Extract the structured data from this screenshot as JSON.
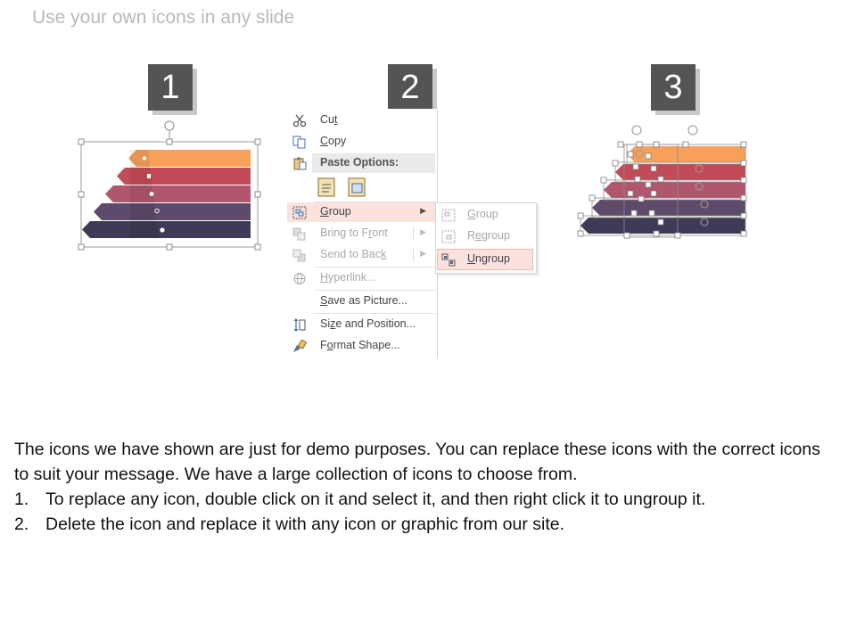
{
  "slide": {
    "title": "Use your own icons in any slide",
    "steps": [
      "1",
      "2",
      "3"
    ]
  },
  "colors": {
    "orange": "#f6a05a",
    "red": "#c24b58",
    "rose": "#b0576d",
    "plum": "#5e4a6a",
    "navy": "#3e3b57",
    "menu_highlight": "#fbe2dd"
  },
  "context_menu": {
    "items": {
      "cut": {
        "pre": "Cu",
        "key": "t",
        "post": "",
        "icon": "scissors-icon"
      },
      "copy": {
        "pre": "",
        "key": "C",
        "post": "opy",
        "icon": "copy-icon"
      },
      "paste_options": {
        "label": "Paste Options:",
        "icon": "clipboard-icon"
      },
      "group": {
        "pre": "",
        "key": "G",
        "post": "roup",
        "icon": "group-icon"
      },
      "bring_to_front": {
        "pre": "Bring to F",
        "key": "r",
        "post": "ont",
        "icon": "bring-front-icon"
      },
      "send_to_back": {
        "pre": "Send to Bac",
        "key": "k",
        "post": "",
        "icon": "send-back-icon"
      },
      "hyperlink": {
        "pre": "",
        "key": "H",
        "post": "yperlink...",
        "icon": "hyperlink-icon"
      },
      "save_as_picture": {
        "pre": "",
        "key": "S",
        "post": "ave as Picture...",
        "icon": ""
      },
      "size_and_position": {
        "pre": "Si",
        "key": "z",
        "post": "e and Position...",
        "icon": "size-position-icon"
      },
      "format_shape": {
        "pre": "F",
        "key": "o",
        "post": "rmat Shape...",
        "icon": "format-shape-icon"
      }
    },
    "submenu": {
      "group": {
        "pre": "",
        "key": "G",
        "post": "roup"
      },
      "regroup": {
        "pre": "R",
        "key": "e",
        "post": "group"
      },
      "ungroup": {
        "pre": "",
        "key": "U",
        "post": "ngroup"
      }
    }
  },
  "body": {
    "paragraph": "The icons we have shown are just for demo purposes. You can replace these icons with the correct icons to suit your message. We have a large collection of icons to choose from.",
    "steps": [
      {
        "num": "1.",
        "text": "To replace any icon, double click on it and select it, and then right click it to ungroup it."
      },
      {
        "num": "2.",
        "text": "Delete the icon and replace it with any icon or graphic from our site."
      }
    ]
  }
}
